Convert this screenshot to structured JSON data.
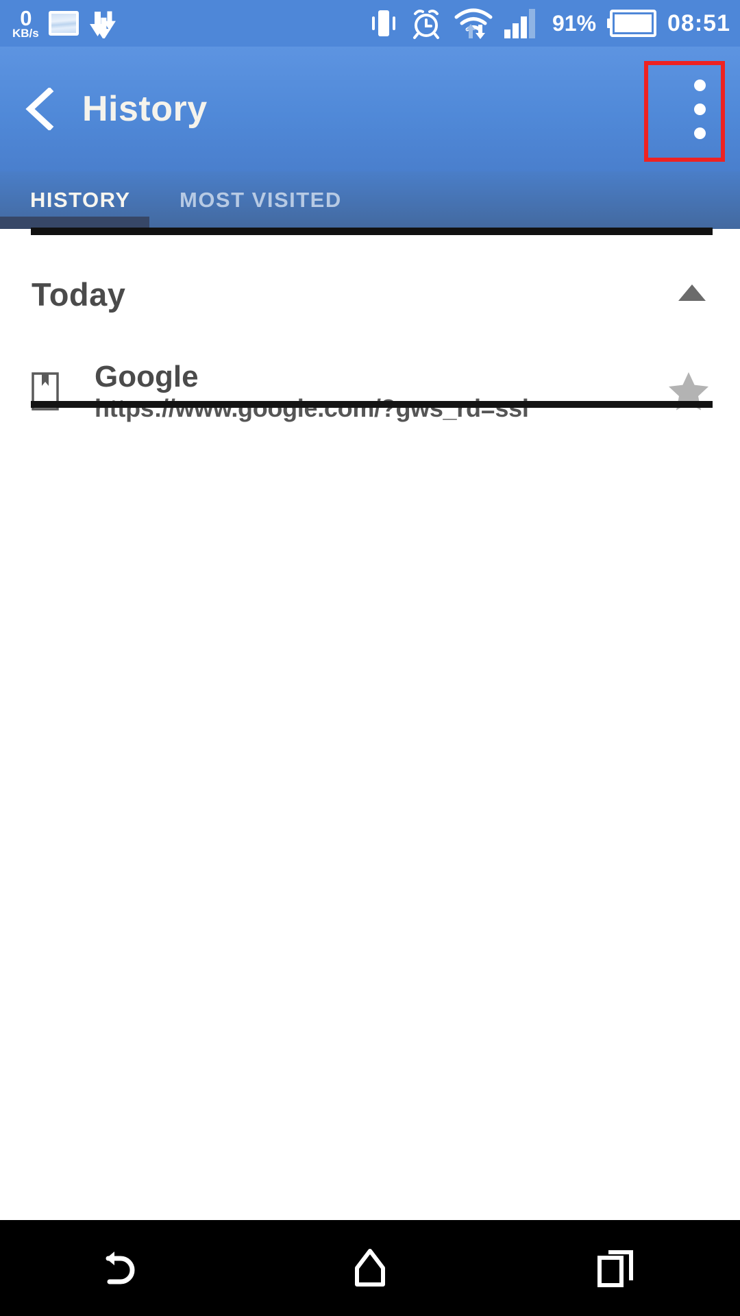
{
  "status_bar": {
    "network_speed_value": "0",
    "network_speed_unit": "KB/s",
    "icons": [
      "image-icon",
      "download-icon",
      "vibrate-icon",
      "alarm-icon",
      "wifi-icon",
      "signal-icon"
    ],
    "battery_percent": "91%",
    "clock": "08:51",
    "background_color": "#4e87d8"
  },
  "app_bar": {
    "back_icon": "chevron-left-icon",
    "title": "History",
    "overflow_icon": "more-vertical-icon",
    "gradient_top": "#5d94e1",
    "gradient_bottom": "#4a7fcd"
  },
  "annotation": {
    "shape": "rectangle",
    "color": "#ee2222",
    "target": "overflow-menu-button"
  },
  "tabs": {
    "items": [
      {
        "label": "HISTORY",
        "selected": true
      },
      {
        "label": "MOST VISITED",
        "selected": false
      }
    ],
    "indicator_color": "#374767",
    "active_text_color": "#f7f5ef",
    "inactive_text_color": "#b7cae4"
  },
  "content": {
    "group": {
      "title": "Today",
      "collapse_icon": "triangle-up-icon",
      "expanded": true
    },
    "items": [
      {
        "favicon": "page-bookmark-icon",
        "title": "Google",
        "url": "https://www.google.com/?gws_rd=ssl",
        "star_icon": "star-icon",
        "star_color": "#b3b3b3"
      }
    ],
    "divider_color": "#131313"
  },
  "nav_bar": {
    "background_color": "#000000",
    "buttons": [
      {
        "name": "back",
        "icon": "back-arrow-icon"
      },
      {
        "name": "home",
        "icon": "home-icon"
      },
      {
        "name": "recents",
        "icon": "recents-icon"
      }
    ]
  }
}
